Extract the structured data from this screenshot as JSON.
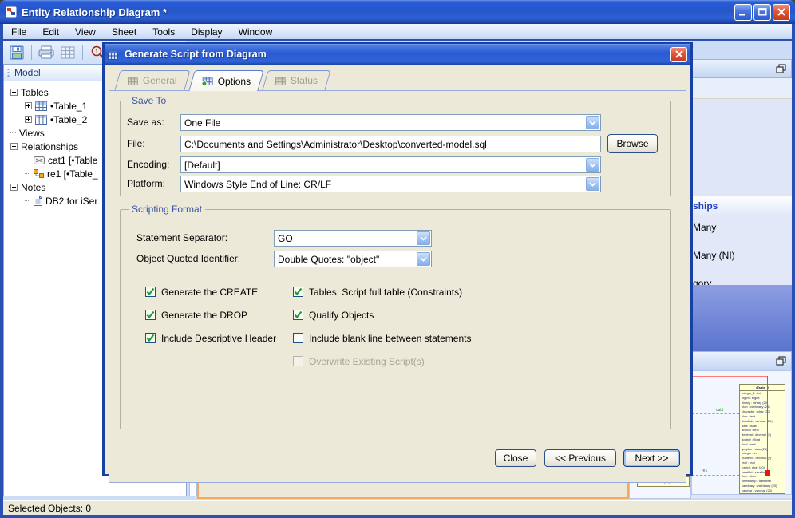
{
  "window": {
    "title": "Entity Relationship Diagram *"
  },
  "menu_items": [
    "File",
    "Edit",
    "View",
    "Sheet",
    "Tools",
    "Display",
    "Window"
  ],
  "toolbar": {
    "icons": [
      "save",
      "print",
      "grid",
      "zoom-actual",
      "zoom-in"
    ]
  },
  "model_panel": {
    "title": "Model",
    "items": [
      {
        "label": "Tables",
        "expander": "minus",
        "icon": null,
        "level": 0
      },
      {
        "label": "•Table_1",
        "expander": "plus",
        "icon": "table",
        "level": 1
      },
      {
        "label": "•Table_2",
        "expander": "plus",
        "icon": "table",
        "level": 1
      },
      {
        "label": "Views",
        "expander": null,
        "icon": null,
        "level": 0
      },
      {
        "label": "Relationships",
        "expander": "minus",
        "icon": null,
        "level": 0
      },
      {
        "label": "cat1 [•Table",
        "expander": null,
        "icon": "category",
        "level": 1
      },
      {
        "label": "re1 [•Table_",
        "expander": null,
        "icon": "relationship",
        "level": 1
      },
      {
        "label": "Notes",
        "expander": "minus",
        "icon": null,
        "level": 0
      },
      {
        "label": "DB2 for iSer",
        "expander": null,
        "icon": "note",
        "level": 1
      }
    ]
  },
  "dialog": {
    "title": "Generate Script from Diagram",
    "tabs": [
      {
        "label": "General",
        "state": "disabled"
      },
      {
        "label": "Options",
        "state": "active"
      },
      {
        "label": "Status",
        "state": "disabled"
      }
    ],
    "save_to": {
      "legend": "Save To",
      "save_as_label": "Save as:",
      "save_as_value": "One File",
      "file_label": "File:",
      "file_value": "C:\\Documents and Settings\\Administrator\\Desktop\\converted-model.sql",
      "browse_label": "Browse",
      "encoding_label": "Encoding:",
      "encoding_value": "[Default]",
      "platform_label": "Platform:",
      "platform_value": "Windows Style End of Line: CR/LF"
    },
    "scripting_format": {
      "legend": "Scripting Format",
      "statement_separator_label": "Statement Separator:",
      "statement_separator_value": "GO",
      "quoted_identifier_label": "Object Quoted Identifier:",
      "quoted_identifier_value": "Double Quotes: \"object\"",
      "checkboxes_left": [
        {
          "label": "Generate the CREATE",
          "checked": true
        },
        {
          "label": "Generate the DROP",
          "checked": true
        },
        {
          "label": "Include Descriptive Header",
          "checked": true
        }
      ],
      "checkboxes_right": [
        {
          "label": "Tables: Script full table (Constraints)",
          "checked": true
        },
        {
          "label": "Qualify Objects",
          "checked": true
        },
        {
          "label": "Include blank line between statements",
          "checked": false
        },
        {
          "label": "Overwrite Existing Script(s)",
          "checked": false,
          "disabled": true
        }
      ]
    },
    "buttons": {
      "close": "Close",
      "previous": "<< Previous",
      "next": "Next >>"
    }
  },
  "right_panel": {
    "palette_header": "ships",
    "items": [
      "Many",
      "Many (NI)",
      "gory"
    ]
  },
  "canvas": {
    "entity_table": {
      "title": "•Table_2",
      "rows": [
        "integer_1 : int",
        "bigint : bigint",
        "binary : binary (20)",
        "blob : varbinary (20)",
        "character : char (20)",
        "clob : text",
        "datalink : varchar (20)",
        "date : date",
        "dbclob : text",
        "decimal : decimal (5)",
        "double : float",
        "float : real",
        "graphic : char (20)",
        "integer : int",
        "numeric : decimal (2)",
        "real : real",
        "rowid : char (20)",
        "smallint : smallint",
        "time : time",
        "timestamp : datetime",
        "varbinary : varbinary (20)",
        "varchar : varchar (20)"
      ]
    },
    "connector_labels": {
      "first": "cat1",
      "second": "re1"
    },
    "fragment_row": "varchar : varchar (20)"
  },
  "status_bar": {
    "text": "Selected Objects: 0"
  },
  "colors": {
    "titlebar_blue": "#2456c9",
    "dialog_bg": "#ece9d8",
    "dialog_border": "#1741a5",
    "selection_red": "#ff3a3a",
    "entity_yellow": "#ffffd8",
    "connector_green": "#1a8a1a",
    "orange_border": "#f5a95f",
    "group_legend_blue": "#3a55a5"
  }
}
